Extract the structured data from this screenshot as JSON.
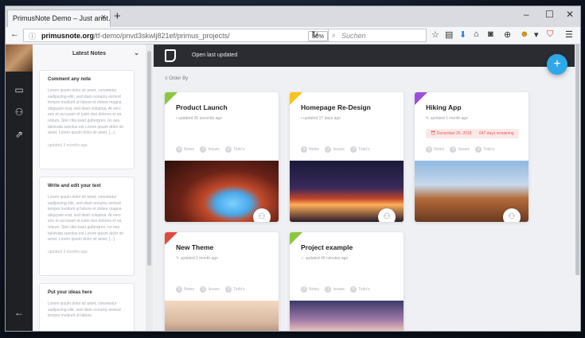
{
  "browser": {
    "tab_title": "PrimusNote Demo – Just anot…",
    "tab_close": "×",
    "new_tab": "+",
    "url_domain": "primusnote.org",
    "url_path": "/tf-demo/pnvd3skwlj821ef/primus_projects/",
    "zoom": "80%",
    "search_placeholder": "Suchen"
  },
  "notes_panel": {
    "title": "Latest Notes",
    "notes": [
      {
        "title": "Comment any note",
        "body": "Lorem ipsum dolor sit amet, consetetur sadipscing elitr, sed diam nonumy eirmod tempor invidunt ut labore et dolore magna aliquyam erat, sed diam voluptua. At vero eos et accusam et justo duo dolores et ea rebum. Stet clita kasd gubergren, no sea takimata sanctus est Lorem ipsum dolor sit amet. Lorem ipsum dolor sit amet, [...]",
        "updated": "updated 3 months ago"
      },
      {
        "title": "Write and edit your text",
        "body": "Lorem ipsum dolor sit amet, consetetur sadipscing elitr, sed diam nonumy eirmod tempor invidunt ut labore et dolore magna aliquyam erat, sed diam voluptua. At vero eos et accusam et justo duo dolores et ea rebum. Stet clita kasd gubergren, no sea takimata sanctus est Lorem ipsum dolor sit amet. Lorem ipsum dolor sit amet, [...]",
        "updated": "updated 3 months ago"
      },
      {
        "title": "Put your ideas here",
        "body": "Lorem ipsum dolor sit amet, consetetur sadipscing elitr, sed diam nonumy eirmod tempor invidunt ut labore",
        "updated": ""
      }
    ]
  },
  "main": {
    "open_last_updated": "Open last updated",
    "order_by": "Order By",
    "fab_label": "+",
    "projects": [
      {
        "name": "Product Launch",
        "updated": "updated 36 seconds ago",
        "due": "",
        "notes": "3",
        "issues": "3",
        "todos": "3",
        "notes_label": "Notes",
        "issues_label": "Issues",
        "todos_label": "Todo's",
        "accent": "#8cc63f"
      },
      {
        "name": "Homepage Re-Design",
        "updated": "updated 17 days ago",
        "due": "",
        "notes": "3",
        "issues": "3",
        "todos": "3",
        "notes_label": "Notes",
        "issues_label": "Issues",
        "todos_label": "Todo's",
        "accent": "#f7c31c"
      },
      {
        "name": "Hiking App",
        "updated": "updated 1 month ago",
        "due": "December 26, 2018",
        "remaining": "647 days remaining",
        "notes": "3",
        "issues": "3",
        "todos": "3",
        "notes_label": "Notes",
        "issues_label": "Issues",
        "todos_label": "Todo's",
        "accent": "#9b4fd8"
      },
      {
        "name": "New Theme",
        "updated": "updated 1 month ago",
        "due": "",
        "notes": "3",
        "issues": "3",
        "todos": "3",
        "notes_label": "Notes",
        "issues_label": "Issues",
        "todos_label": "Todo's",
        "accent": "#e04a3a"
      },
      {
        "name": "Project example",
        "updated": "updated 48 minutes ago",
        "due": "",
        "notes": "3",
        "issues": "3",
        "todos": "6",
        "notes_label": "Notes",
        "issues_label": "Issues",
        "todos_label": "Todo's",
        "accent": "#8cc63f"
      }
    ]
  },
  "icons": {
    "share": "users-icon",
    "inbox": "inbox-icon",
    "team": "team-icon",
    "external": "external-link-icon",
    "back": "back-arrow-icon"
  }
}
